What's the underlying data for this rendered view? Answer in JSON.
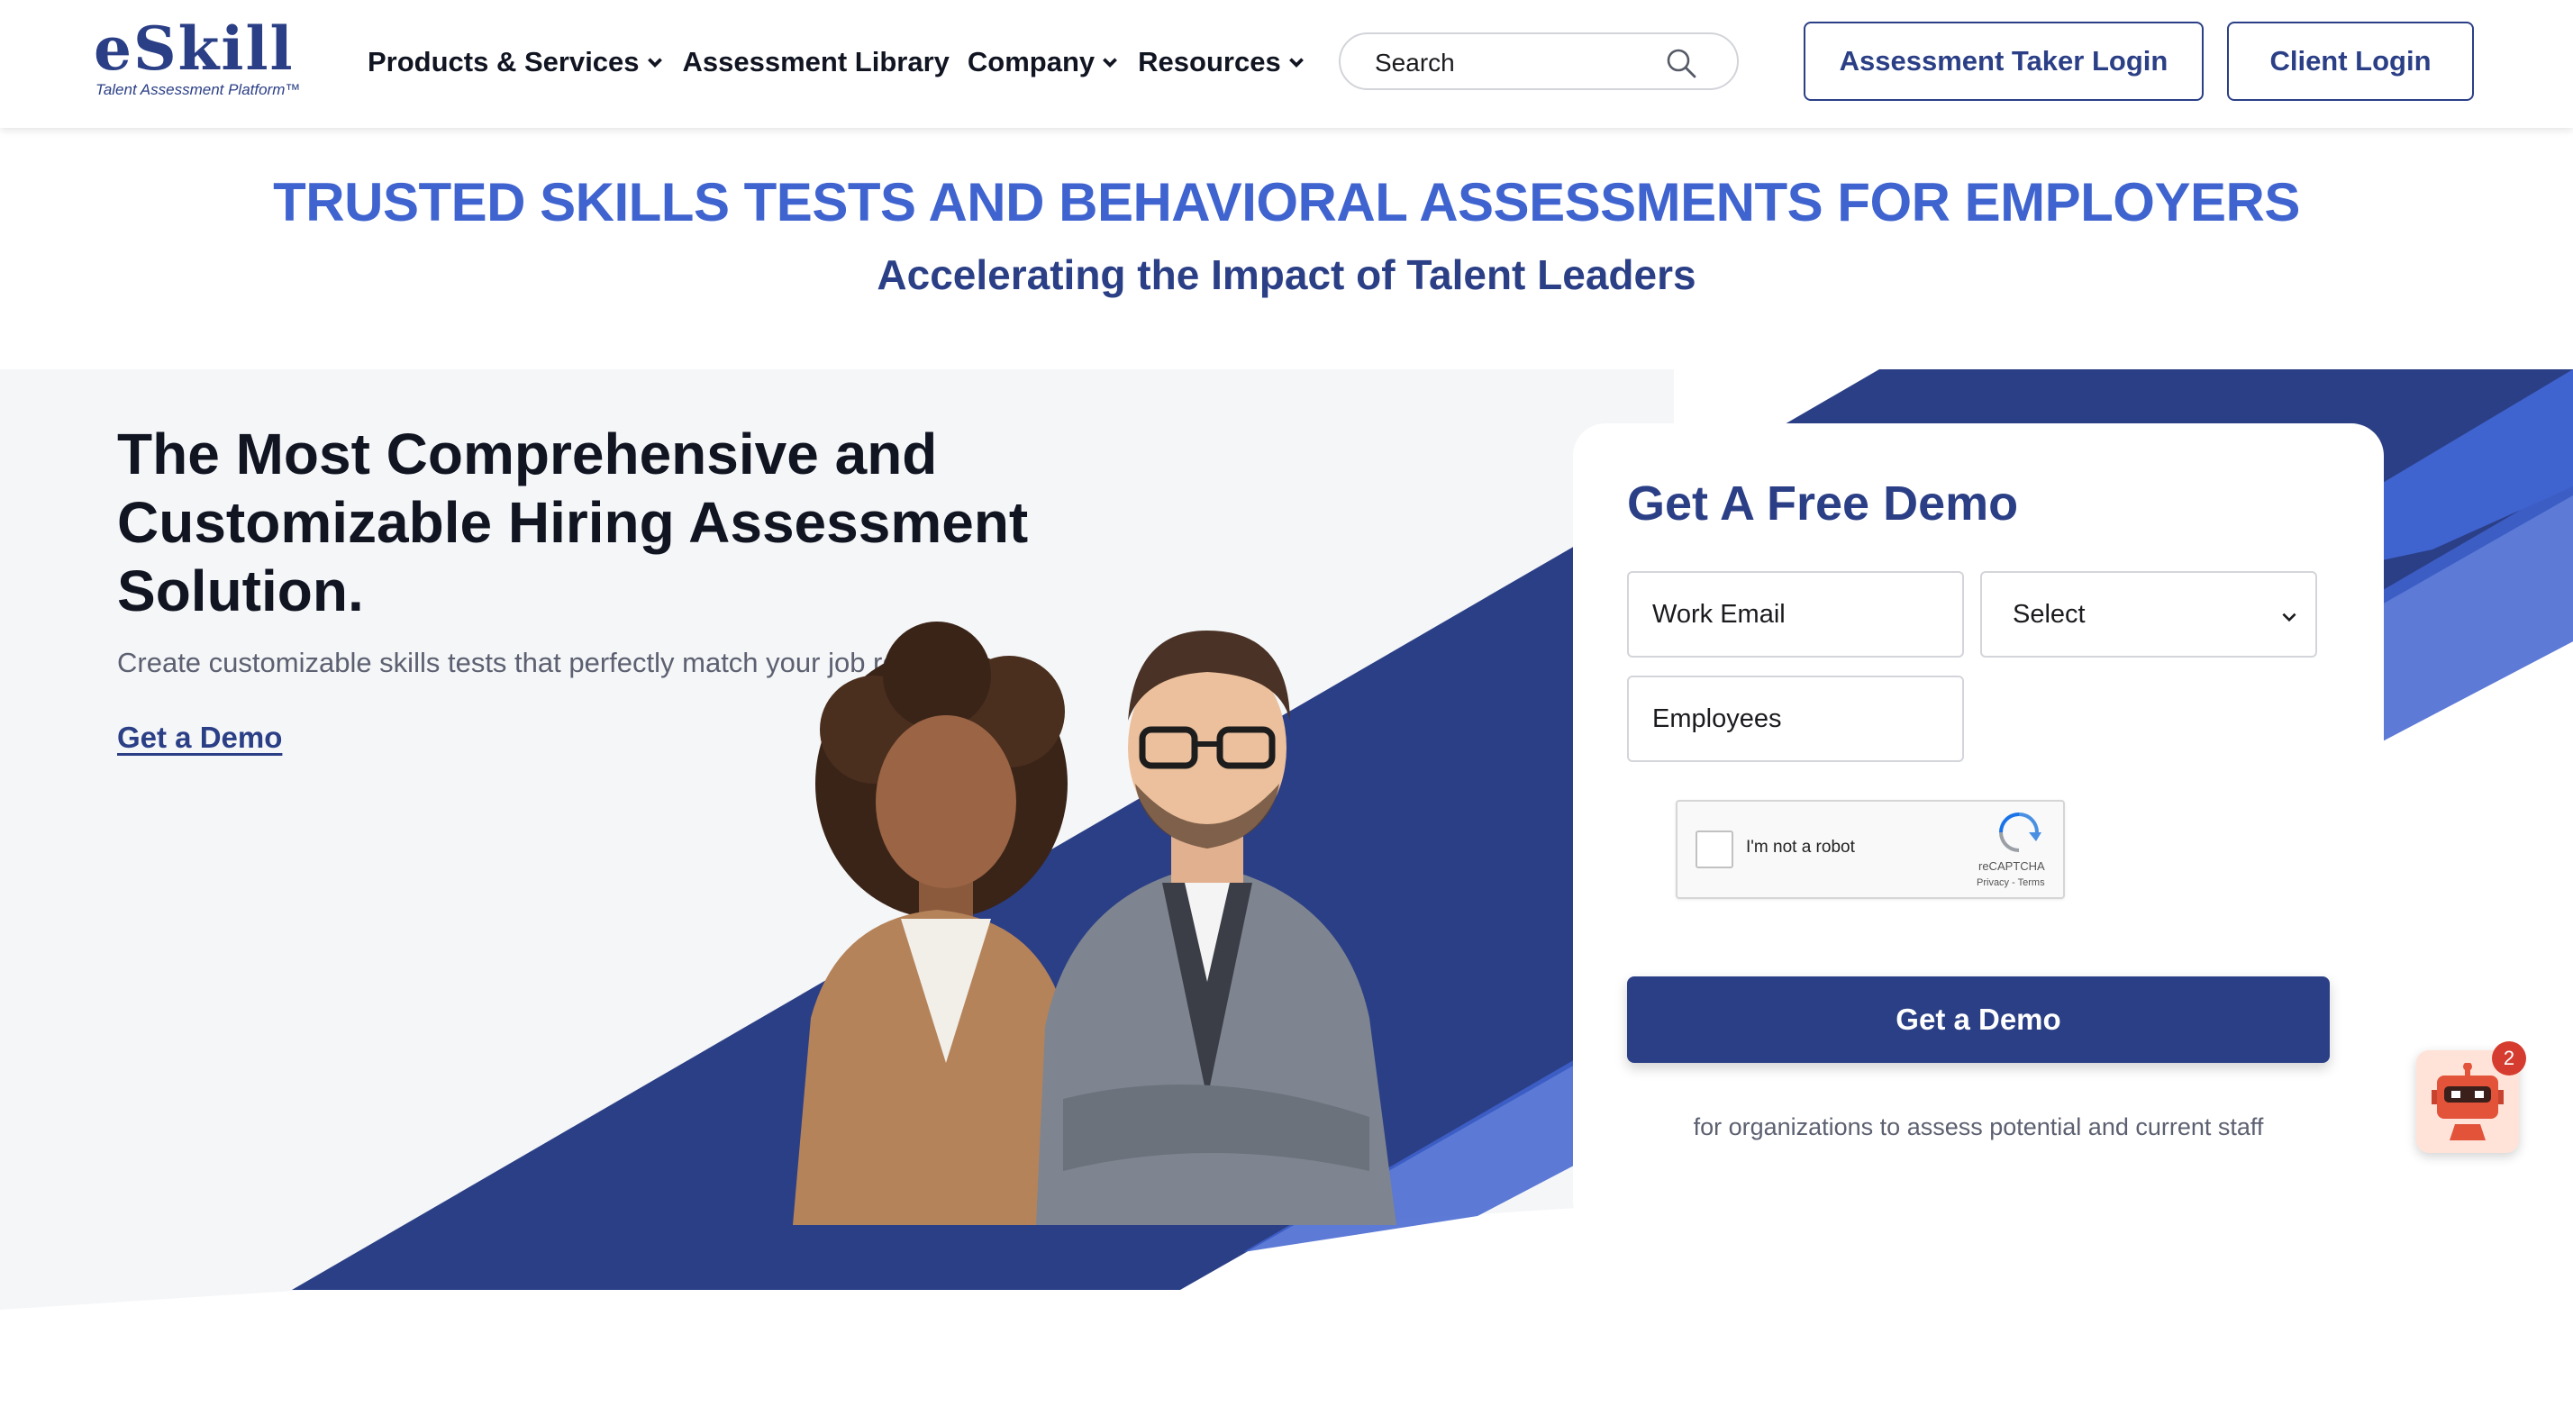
{
  "brand": {
    "name": "eSkill",
    "tagline": "Talent Assessment Platform™",
    "primary_color": "#2b3f86",
    "accent_color": "#3f63cf"
  },
  "nav": {
    "items": [
      {
        "label": "Products & Services",
        "has_dropdown": true
      },
      {
        "label": "Assessment Library",
        "has_dropdown": false
      },
      {
        "label": "Company",
        "has_dropdown": true
      },
      {
        "label": "Resources",
        "has_dropdown": true
      }
    ],
    "search_placeholder": "Search",
    "search_icon": "magnifier-icon",
    "assessment_taker_login": "Assessment Taker Login",
    "client_login": "Client Login"
  },
  "banner": {
    "headline": "TRUSTED SKILLS TESTS AND BEHAVIORAL ASSESSMENTS FOR EMPLOYERS",
    "subheadline": "Accelerating the Impact of Talent Leaders"
  },
  "hero": {
    "title": "The Most Comprehensive and Customizable Hiring Assessment Solution.",
    "subtitle": "Create customizable skills tests that perfectly match your job roles.",
    "cta_link": "Get a Demo",
    "image": "two-professionals-photo"
  },
  "demo_form": {
    "title": "Get A Free Demo",
    "work_email_placeholder": "Work Email",
    "select_value": "Select",
    "employees_placeholder": "Employees",
    "captcha": {
      "label": "I'm not a robot",
      "brand": "reCAPTCHA",
      "terms": "Privacy - Terms"
    },
    "submit_label": "Get a Demo",
    "note": "for organizations to assess potential and current staff"
  },
  "chat_widget": {
    "icon": "robot-icon",
    "badge_count": "2"
  }
}
